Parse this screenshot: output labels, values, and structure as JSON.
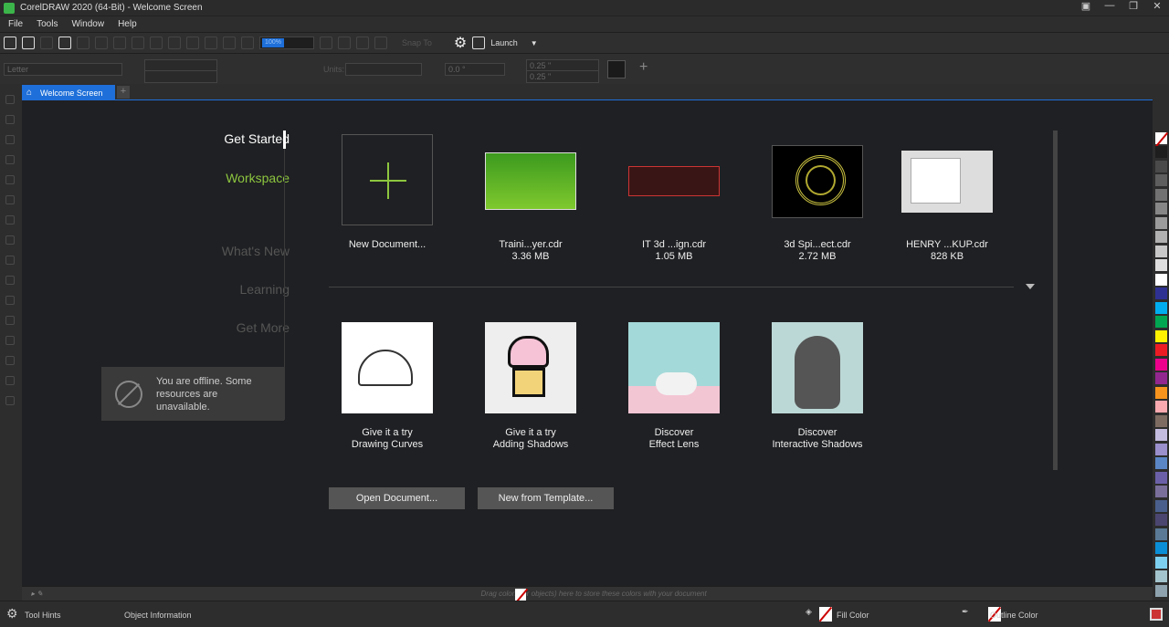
{
  "title": "CorelDRAW 2020 (64-Bit) - Welcome Screen",
  "menu": [
    "File",
    "Tools",
    "Window",
    "Help"
  ],
  "toolbar": {
    "zoom": "100%",
    "snap": "Snap To",
    "launch": "Launch"
  },
  "propbar": {
    "page_size": "Letter",
    "units": "Units:",
    "angle": "0.0 °",
    "nudge1": "0.25 \"",
    "nudge2": "0.25 \""
  },
  "tab": {
    "label": "Welcome Screen"
  },
  "nav": {
    "get_started": "Get Started",
    "workspace": "Workspace",
    "whats_new": "What's New",
    "learning": "Learning",
    "get_more": "Get More"
  },
  "offline": "You are offline. Some resources are unavailable.",
  "recent": [
    {
      "name": "New Document...",
      "size": ""
    },
    {
      "name": "Traini...yer.cdr",
      "size": "3.36 MB"
    },
    {
      "name": "IT 3d ...ign.cdr",
      "size": "1.05 MB"
    },
    {
      "name": "3d Spi...ect.cdr",
      "size": "2.72 MB"
    },
    {
      "name": "HENRY ...KUP.cdr",
      "size": "828 KB"
    }
  ],
  "learn": [
    {
      "line1": "Give it a try",
      "line2": "Drawing Curves"
    },
    {
      "line1": "Give it a try",
      "line2": "Adding Shadows"
    },
    {
      "line1": "Discover",
      "line2": "Effect Lens"
    },
    {
      "line1": "Discover",
      "line2": "Interactive Shadows"
    }
  ],
  "buttons": {
    "open": "Open Document...",
    "template": "New from Template..."
  },
  "docker_hint": "Drag colors (or objects) here to store these colors with your document",
  "status": {
    "tool_hints": "Tool Hints",
    "object_info": "Object Information",
    "fill": "Fill Color",
    "outline": "Outline Color"
  },
  "palette": [
    "#1e1e1e",
    "#4a4a4a",
    "#5e5e5e",
    "#727272",
    "#878787",
    "#9b9b9b",
    "#b1b1b1",
    "#c8c8c8",
    "#dedede",
    "#ffffff",
    "#2e3192",
    "#00aeef",
    "#00a651",
    "#fff200",
    "#ed1c24",
    "#ec008c",
    "#92278f",
    "#f7941d",
    "#f9a9b0",
    "#7d6b62",
    "#c4bde0",
    "#9b8fcc",
    "#5b86c5",
    "#6b60a8",
    "#7a6f9b",
    "#4a5f8c",
    "#4b4670",
    "#5a7a96",
    "#0a8fd6",
    "#7dd0f0",
    "#a3c4cc",
    "#8ea3ad"
  ],
  "accent": "#1e6fd9",
  "green": "#8dc63f"
}
